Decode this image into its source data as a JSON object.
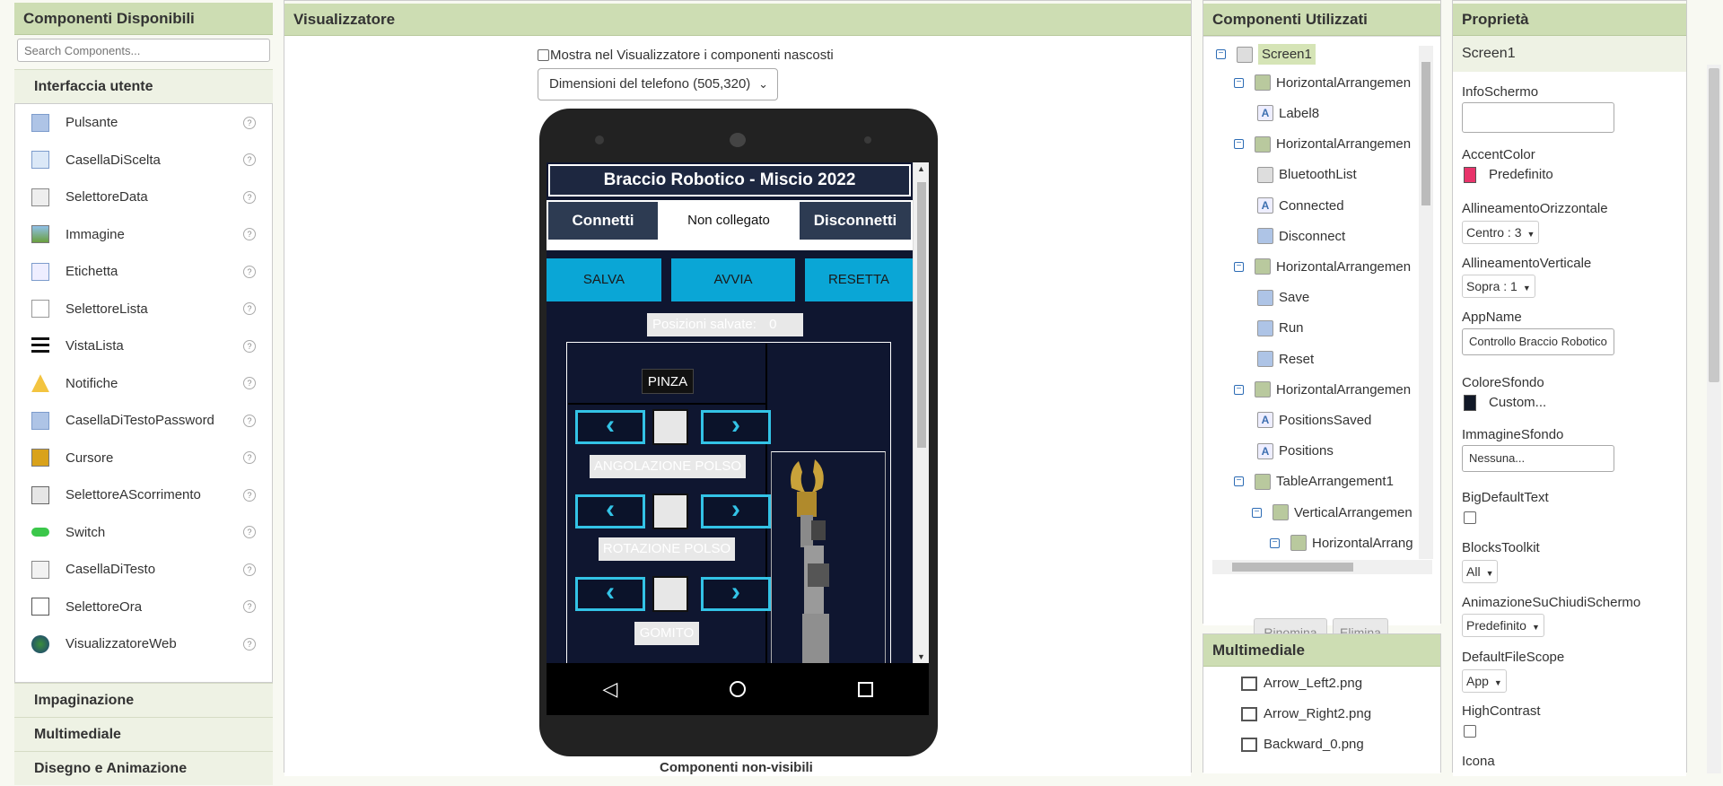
{
  "palette": {
    "title": "Componenti Disponibili",
    "search_placeholder": "Search Components...",
    "open_drawer": "Interfaccia utente",
    "items": [
      {
        "label": "Pulsante",
        "icon": "button-icon"
      },
      {
        "label": "CasellaDiScelta",
        "icon": "checkbox-icon"
      },
      {
        "label": "SelettoreData",
        "icon": "datepicker-icon"
      },
      {
        "label": "Immagine",
        "icon": "image-icon"
      },
      {
        "label": "Etichetta",
        "icon": "label-icon"
      },
      {
        "label": "SelettoreLista",
        "icon": "listpicker-icon"
      },
      {
        "label": "VistaLista",
        "icon": "listview-icon"
      },
      {
        "label": "Notifiche",
        "icon": "notifier-icon"
      },
      {
        "label": "CasellaDiTestoPassword",
        "icon": "password-icon"
      },
      {
        "label": "Cursore",
        "icon": "slider-icon"
      },
      {
        "label": "SelettoreAScorrimento",
        "icon": "spinner-icon"
      },
      {
        "label": "Switch",
        "icon": "switch-icon"
      },
      {
        "label": "CasellaDiTesto",
        "icon": "textbox-icon"
      },
      {
        "label": "SelettoreOra",
        "icon": "timepicker-icon"
      },
      {
        "label": "VisualizzatoreWeb",
        "icon": "webviewer-icon"
      }
    ],
    "help_glyph": "?",
    "drawers": [
      "Impaginazione",
      "Multimediale",
      "Disegno e Animazione"
    ]
  },
  "viewer": {
    "title": "Visualizzatore",
    "show_hidden_label": "Mostra nel Visualizzatore i componenti nascosti",
    "size_select": "Dimensioni del telefono (505,320)",
    "nonvisible_label": "Componenti non-visibili",
    "app": {
      "title": "Braccio Robotico - Miscio 2022",
      "connect": "Connetti",
      "status": "Non collegato",
      "disconnect": "Disconnetti",
      "save": "SALVA",
      "run": "AVVIA",
      "reset": "RESETTA",
      "positions_label": "Posizioni salvate:",
      "positions_count": "0",
      "gripper": "PINZA",
      "wrist_angle": "ANGOLAZIONE POLSO",
      "wrist_rotation": "ROTAZIONE POLSO",
      "elbow": "GOMITO"
    }
  },
  "tree": {
    "title": "Componenti Utilizzati",
    "nodes": [
      {
        "label": "Screen1",
        "type": "screen"
      },
      {
        "label": "HorizontalArrangemen",
        "type": "arrangement"
      },
      {
        "label": "Label8",
        "type": "label"
      },
      {
        "label": "HorizontalArrangemen",
        "type": "arrangement"
      },
      {
        "label": "BluetoothList",
        "type": "listpicker"
      },
      {
        "label": "Connected",
        "type": "label"
      },
      {
        "label": "Disconnect",
        "type": "button"
      },
      {
        "label": "HorizontalArrangemen",
        "type": "arrangement"
      },
      {
        "label": "Save",
        "type": "button"
      },
      {
        "label": "Run",
        "type": "button"
      },
      {
        "label": "Reset",
        "type": "button"
      },
      {
        "label": "HorizontalArrangemen",
        "type": "arrangement"
      },
      {
        "label": "PositionsSaved",
        "type": "label"
      },
      {
        "label": "Positions",
        "type": "label"
      },
      {
        "label": "TableArrangement1",
        "type": "table"
      },
      {
        "label": "VerticalArrangemen",
        "type": "vertical"
      },
      {
        "label": "HorizontalArrang",
        "type": "arrangement"
      }
    ],
    "rename": "Rinomina",
    "delete": "Elimina"
  },
  "media": {
    "title": "Multimediale",
    "files": [
      "Arrow_Left2.png",
      "Arrow_Right2.png",
      "Backward_0.png"
    ]
  },
  "props": {
    "title": "Proprietà",
    "component": "Screen1",
    "info_label": "InfoSchermo",
    "accent_label": "AccentColor",
    "accent_value": "Predefinito",
    "accent_color": "#e8336a",
    "halign_label": "AllineamentoOrizzontale",
    "halign_value": "Centro : 3",
    "valign_label": "AllineamentoVerticale",
    "valign_value": "Sopra : 1",
    "appname_label": "AppName",
    "appname_value": "Controllo Braccio Robotico",
    "bg_label": "ColoreSfondo",
    "bg_value": "Custom...",
    "bg_color": "#111827",
    "bgimg_label": "ImmagineSfondo",
    "bgimg_value": "Nessuna...",
    "bigtext_label": "BigDefaultText",
    "blocks_label": "BlocksToolkit",
    "blocks_value": "All",
    "anim_label": "AnimazioneSuChiudiSchermo",
    "anim_value": "Predefinito",
    "scope_label": "DefaultFileScope",
    "scope_value": "App",
    "contrast_label": "HighContrast",
    "icon_label": "Icona"
  }
}
